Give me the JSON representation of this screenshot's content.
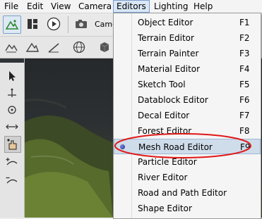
{
  "menubar": {
    "items": [
      "File",
      "Edit",
      "View",
      "Camera",
      "Editors",
      "Lighting",
      "Help"
    ],
    "active_index": 4
  },
  "toolbar": {
    "camera_label": "Came"
  },
  "editors_menu": {
    "items": [
      {
        "label": "Object Editor",
        "shortcut": "F1"
      },
      {
        "label": "Terrain Editor",
        "shortcut": "F2"
      },
      {
        "label": "Terrain Painter",
        "shortcut": "F3"
      },
      {
        "label": "Material Editor",
        "shortcut": "F4"
      },
      {
        "label": "Sketch Tool",
        "shortcut": "F5"
      },
      {
        "label": "Datablock Editor",
        "shortcut": "F6"
      },
      {
        "label": "Decal Editor",
        "shortcut": "F7"
      },
      {
        "label": "Forest Editor",
        "shortcut": "F8"
      },
      {
        "label": "Mesh Road Editor",
        "shortcut": "F9"
      },
      {
        "label": "Particle Editor",
        "shortcut": ""
      },
      {
        "label": "River Editor",
        "shortcut": ""
      },
      {
        "label": "Road and Path Editor",
        "shortcut": ""
      },
      {
        "label": "Shape Editor",
        "shortcut": ""
      }
    ],
    "selected_index": 8
  },
  "colors": {
    "highlight_ring": "#e01818",
    "menu_highlight": "#cfdcea",
    "radio_dot": "#2a3aa0"
  }
}
